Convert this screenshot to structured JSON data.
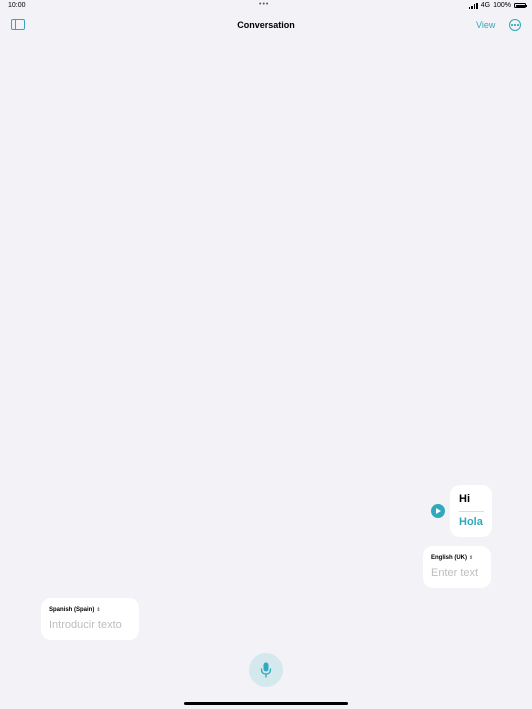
{
  "status_bar": {
    "time": "10:00",
    "network": "4G",
    "battery": "100%",
    "battery_level": 1.0
  },
  "nav": {
    "title": "Conversation",
    "view_label": "View"
  },
  "conversation": [
    {
      "source": "Hi",
      "translation": "Hola"
    }
  ],
  "english_input": {
    "language": "English (UK)",
    "placeholder": "Enter text"
  },
  "spanish_input": {
    "language": "Spanish (Spain)",
    "placeholder": "Introducir texto"
  },
  "icons": [
    "sidebar-icon",
    "more-icon",
    "play-icon",
    "microphone-icon",
    "chevron-updown-icon"
  ],
  "colors": {
    "accent": "#30a9bd",
    "background": "#f2f2f7",
    "mic_background": "#d3e9ee"
  }
}
